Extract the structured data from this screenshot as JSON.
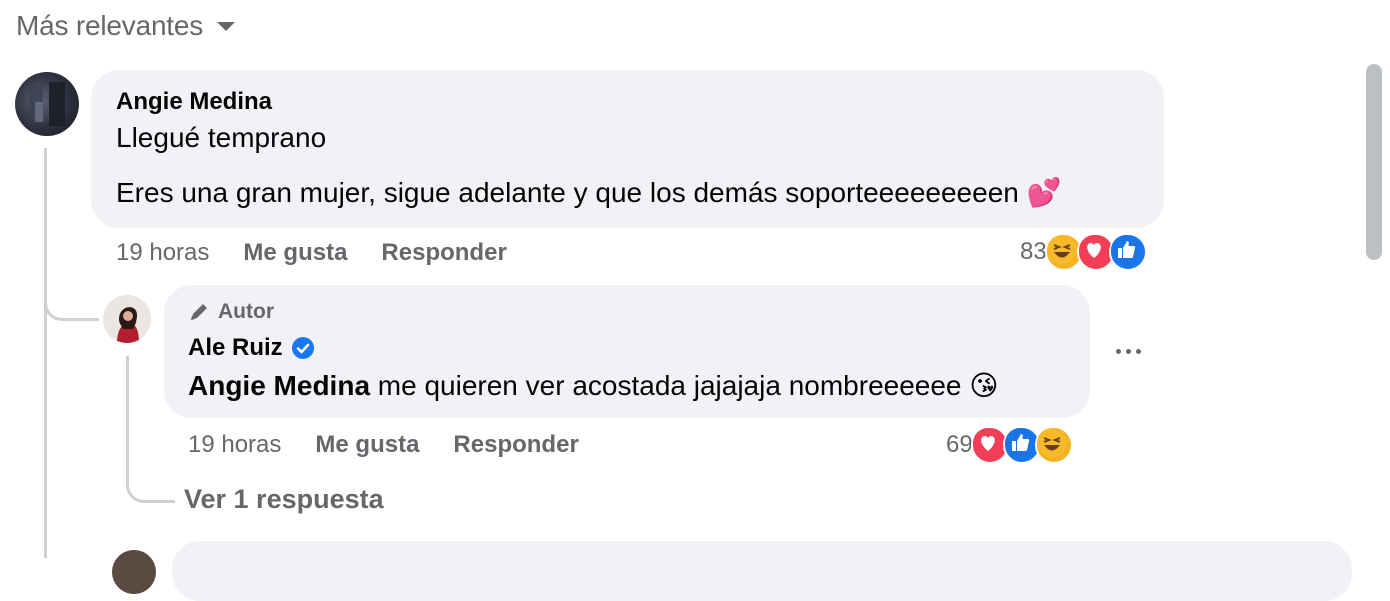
{
  "sort": {
    "label": "Más relevantes"
  },
  "comments": [
    {
      "author": "Angie Medina",
      "lines": [
        "Llegué temprano",
        "Eres una gran mujer, sigue adelante y que los demás soporteeeeeeeeen"
      ],
      "emoji": "💕",
      "time": "19 horas",
      "like": "Me gusta",
      "reply": "Responder",
      "reaction_count": "83",
      "reactions": [
        "haha-icon",
        "love-icon",
        "like-icon"
      ]
    },
    {
      "badge": "Autor",
      "author": "Ale Ruiz",
      "verified": true,
      "mention": "Angie Medina",
      "text": " me quieren ver acostada jajajaja nombreeeeee",
      "emoji": "😘",
      "time": "19 horas",
      "like": "Me gusta",
      "reply": "Responder",
      "reaction_count": "69",
      "reactions": [
        "love-icon",
        "like-icon",
        "haha-icon"
      ]
    }
  ],
  "view_replies": "Ver 1 respuesta",
  "colors": {
    "bubble": "#f0f2f5",
    "secondary_text": "#65676b",
    "verified": "#1877f2"
  }
}
